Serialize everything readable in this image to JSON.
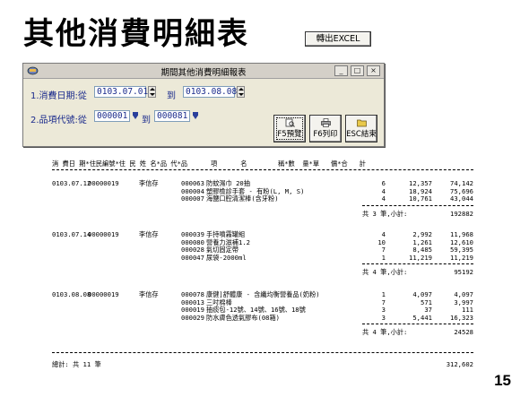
{
  "slide": {
    "title": "其他消費明細表",
    "page_number": "15"
  },
  "window": {
    "title": "期間其他消費明細報表",
    "row1": {
      "label": "1.消費日期:從",
      "from_value": "0103.07.01",
      "to_label": "到",
      "to_value": "0103.08.08"
    },
    "row2": {
      "label": "2.品項代號:從",
      "from_value": "000001",
      "to_label": "到",
      "to_value": "000081"
    },
    "excel_button": "轉出EXCEL",
    "buttons": {
      "preview": "F5預覽",
      "print": "F6列印",
      "exit": "ESC結束"
    }
  },
  "report": {
    "header": "消 費日 期*住民編號*住 民 姓 名*品 代*品      項      名        稱*數  量*單   價*合   計",
    "groups": [
      {
        "date": "0103.07.12",
        "customer_id": "00000019",
        "customer_name": "李信存",
        "items": [
          {
            "code": "000063",
            "name": "防蚊濕巾 20抽",
            "qty": "6",
            "price": "12,357",
            "total": "74,142"
          },
          {
            "code": "000004",
            "name": "塑膠檢診手套 - 有粉(L, M, S)",
            "qty": "4",
            "price": "18,924",
            "total": "75,696"
          },
          {
            "code": "000007",
            "name": "海鹽口腔清潔棒(含牙粉)",
            "qty": "4",
            "price": "10,761",
            "total": "43,044"
          }
        ],
        "subtotal_label": "共 3 筆,小計:",
        "subtotal": "192882"
      },
      {
        "date": "0103.07.14",
        "customer_id": "00000019",
        "customer_name": "李信存",
        "items": [
          {
            "code": "000039",
            "name": "手持噴霧罐組",
            "qty": "4",
            "price": "2,992",
            "total": "11,968"
          },
          {
            "code": "000080",
            "name": "營養力滋補1.2",
            "qty": "10",
            "price": "1,261",
            "total": "12,610"
          },
          {
            "code": "000028",
            "name": "氣切固定帶",
            "qty": "7",
            "price": "8,485",
            "total": "59,395"
          },
          {
            "code": "000047",
            "name": "尿袋-2000ml",
            "qty": "1",
            "price": "11,219",
            "total": "11,219"
          }
        ],
        "subtotal_label": "共 4 筆,小計:",
        "subtotal": "95192"
      },
      {
        "date": "0103.08.08",
        "customer_id": "00000019",
        "customer_name": "李信存",
        "items": [
          {
            "code": "000078",
            "name": "康健]舒體康 - 含纖均衡營養品(奶粉)",
            "qty": "1",
            "price": "4,097",
            "total": "4,097"
          },
          {
            "code": "000013",
            "name": "三吋棉棒",
            "qty": "7",
            "price": "571",
            "total": "3,997"
          },
          {
            "code": "000019",
            "name": "抽痰包-12號、14號、16號、18號",
            "qty": "3",
            "price": "37",
            "total": "111"
          },
          {
            "code": "000029",
            "name": "防水膚色透氣膠布(08箱)",
            "qty": "3",
            "price": "5,441",
            "total": "16,323"
          }
        ],
        "subtotal_label": "共 4 筆,小計:",
        "subtotal": "24528"
      }
    ],
    "grand_total_label": "總計: 共 11 筆",
    "grand_total": "312,602"
  }
}
